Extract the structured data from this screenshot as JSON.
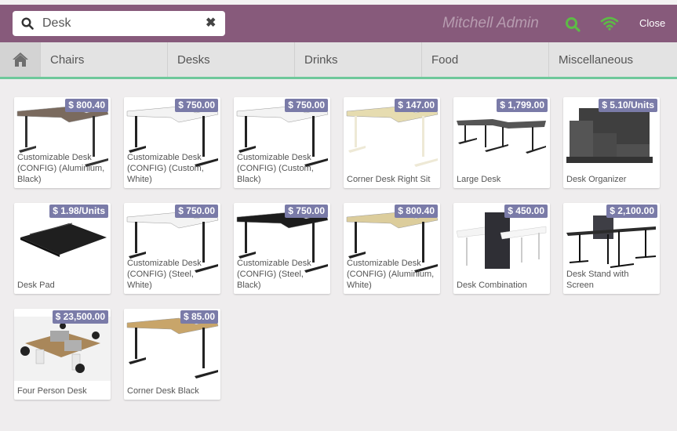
{
  "header": {
    "search_value": "Desk",
    "user_name": "Mitchell Admin",
    "close_label": "Close",
    "icons": {
      "search": "search-icon",
      "clear": "times-icon",
      "user_search": "search-icon",
      "connection": "wifi-icon"
    },
    "connection_color": "#5dbb46",
    "brand_color": "#875a7b"
  },
  "categories": [
    {
      "label": "Chairs"
    },
    {
      "label": "Desks"
    },
    {
      "label": "Drinks"
    },
    {
      "label": "Food"
    },
    {
      "label": "Miscellaneous"
    }
  ],
  "products": [
    {
      "name": "Customizable Desk (CONFIG) (Aluminium, Black)",
      "price": "$ 800.40",
      "image": "desk-brown"
    },
    {
      "name": "Customizable Desk (CONFIG) (Custom, White)",
      "price": "$ 750.00",
      "image": "desk-white"
    },
    {
      "name": "Customizable Desk (CONFIG) (Custom, Black)",
      "price": "$ 750.00",
      "image": "desk-white"
    },
    {
      "name": "Corner Desk Right Sit",
      "price": "$ 147.00",
      "image": "desk-birch"
    },
    {
      "name": "Large Desk",
      "price": "$ 1,799.00",
      "image": "desk-large"
    },
    {
      "name": "Desk Organizer",
      "price": "$ 5.10/Units",
      "image": "organizer"
    },
    {
      "name": "Desk Pad",
      "price": "$ 1.98/Units",
      "image": "deskpad"
    },
    {
      "name": "Customizable Desk (CONFIG) (Steel, White)",
      "price": "$ 750.00",
      "image": "desk-white"
    },
    {
      "name": "Customizable Desk (CONFIG) (Steel, Black)",
      "price": "$ 750.00",
      "image": "desk-black"
    },
    {
      "name": "Customizable Desk (CONFIG) (Aluminium, White)",
      "price": "$ 800.40",
      "image": "desk-birch-black"
    },
    {
      "name": "Desk Combination",
      "price": "$ 450.00",
      "image": "desk-combo"
    },
    {
      "name": "Desk Stand with Screen",
      "price": "$ 2,100.00",
      "image": "desk-screen"
    },
    {
      "name": "Four Person Desk",
      "price": "$ 23,500.00",
      "image": "four-person"
    },
    {
      "name": "Corner Desk Black",
      "price": "$ 85.00",
      "image": "desk-oak"
    }
  ],
  "price_badge_color": "#7a7ba8",
  "accent_color": "#6ec89b"
}
